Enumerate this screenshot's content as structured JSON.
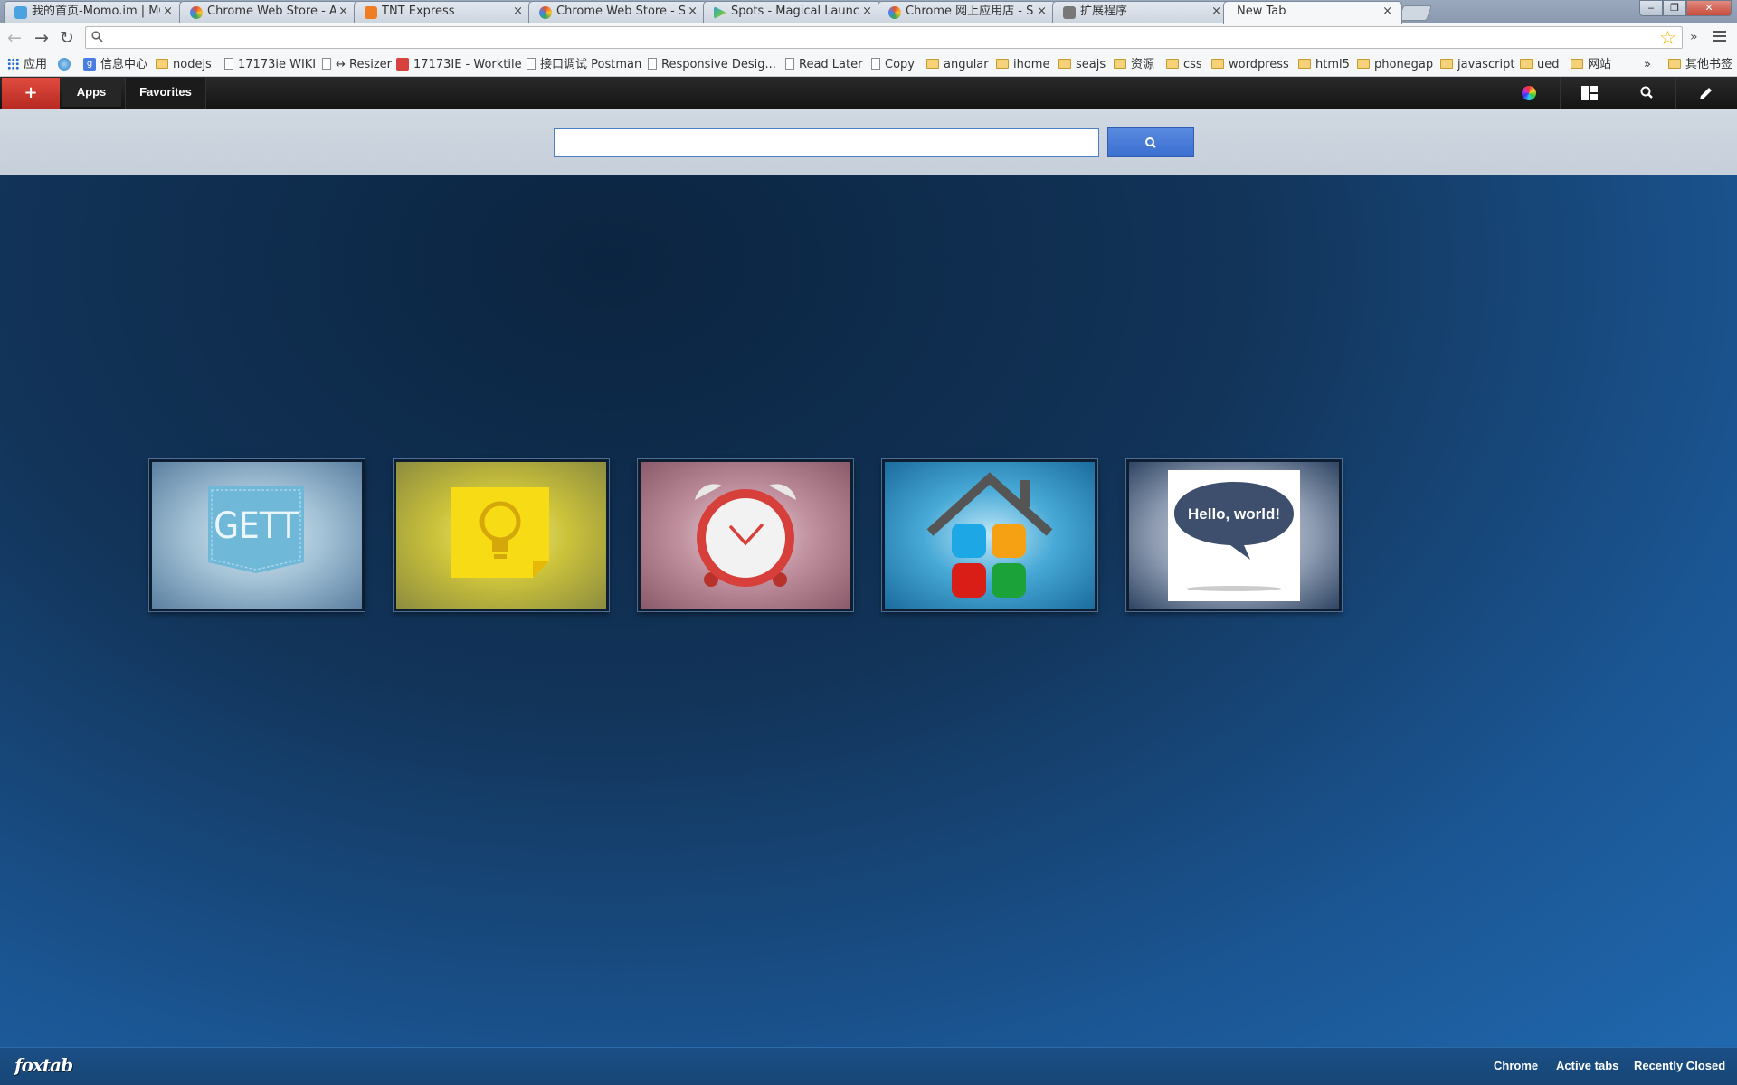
{
  "browser": {
    "tabs": [
      {
        "title": "我的首页-Momo.im | MC",
        "favicon_color": "#4aa3df"
      },
      {
        "title": "Chrome Web Store - Ap",
        "favicon_color": "#e8542f"
      },
      {
        "title": "TNT Express",
        "favicon_color": "#ef7d23"
      },
      {
        "title": "Chrome Web Store - SF",
        "favicon_color": "#e8542f"
      },
      {
        "title": "Spots - Magical Launch",
        "favicon_color": "#3b9ad9"
      },
      {
        "title": "Chrome 网上应用店 - SP",
        "favicon_color": "#e8542f"
      },
      {
        "title": "扩展程序",
        "favicon_color": "#777777"
      },
      {
        "title": "New Tab",
        "favicon_color": ""
      }
    ],
    "tab_close_glyph": "×",
    "omnibox": {
      "value": "",
      "placeholder": ""
    },
    "extensions_overflow": "»",
    "bookmarks": [
      {
        "label": "应用",
        "icon": "apps-grid-icon"
      },
      {
        "label": "",
        "icon": "globe-icon"
      },
      {
        "label": "信息中心",
        "icon": "google-icon"
      },
      {
        "label": "nodejs",
        "icon": "folder-icon"
      },
      {
        "label": "17173ie WIKI",
        "icon": "page-icon"
      },
      {
        "label": "↔ Resizer",
        "icon": "page-icon"
      },
      {
        "label": "17173IE - Worktile",
        "icon": "worktile-icon"
      },
      {
        "label": "接口调试 Postman",
        "icon": "page-icon"
      },
      {
        "label": "Responsive Desig...",
        "icon": "page-icon"
      },
      {
        "label": "Read Later",
        "icon": "page-icon"
      },
      {
        "label": "Copy",
        "icon": "page-icon"
      },
      {
        "label": "angular",
        "icon": "folder-icon"
      },
      {
        "label": "ihome",
        "icon": "folder-icon"
      },
      {
        "label": "seajs",
        "icon": "folder-icon"
      },
      {
        "label": "资源",
        "icon": "folder-icon"
      },
      {
        "label": "css",
        "icon": "folder-icon"
      },
      {
        "label": "wordpress",
        "icon": "folder-icon"
      },
      {
        "label": "html5",
        "icon": "folder-icon"
      },
      {
        "label": "phonegap",
        "icon": "folder-icon"
      },
      {
        "label": "javascript",
        "icon": "folder-icon"
      },
      {
        "label": "ued",
        "icon": "folder-icon"
      },
      {
        "label": "网站",
        "icon": "folder-icon"
      }
    ],
    "bookmarks_overflow": "»",
    "other_bookmarks": "其他书签"
  },
  "foxtab": {
    "add_label": "+",
    "tabs": {
      "apps": "Apps",
      "favorites": "Favorites"
    },
    "search": {
      "value": "",
      "placeholder": ""
    },
    "tiles": [
      {
        "name": "gett",
        "logo_text": "GETT"
      },
      {
        "name": "google-keep",
        "logo_text": ""
      },
      {
        "name": "alarm-clock",
        "logo_text": ""
      },
      {
        "name": "app-launcher",
        "logo_text": ""
      },
      {
        "name": "hello-world",
        "logo_text": "Hello, world!"
      }
    ],
    "footer": {
      "logo": "foxtab",
      "links": {
        "chrome": "Chrome",
        "active_tabs": "Active tabs",
        "recently_closed": "Recently Closed"
      }
    }
  },
  "colors": {
    "accent_red": "#d6392f",
    "search_button": "#4a7de0",
    "bg_dark": "#0b2440",
    "bg_light": "#2068ae"
  }
}
